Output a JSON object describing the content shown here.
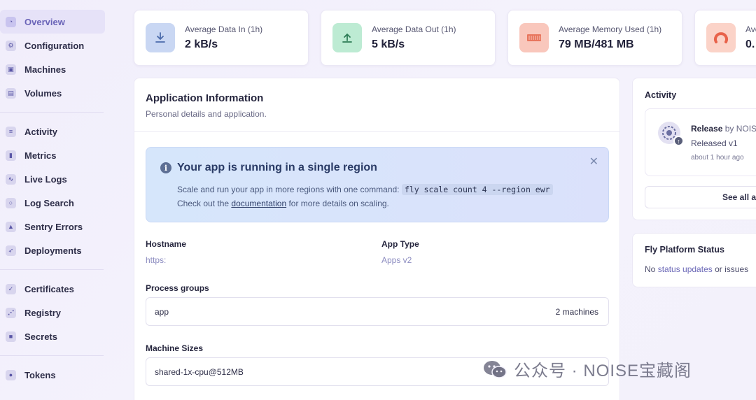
{
  "sidebar": {
    "items": [
      {
        "label": "Overview",
        "icon": "chart-pie-icon",
        "active": true
      },
      {
        "label": "Configuration",
        "icon": "gear-icon"
      },
      {
        "label": "Machines",
        "icon": "cpu-icon"
      },
      {
        "label": "Volumes",
        "icon": "box-icon"
      },
      {
        "label": "Activity",
        "icon": "activity-icon"
      },
      {
        "label": "Metrics",
        "icon": "bar-chart-icon"
      },
      {
        "label": "Live Logs",
        "icon": "waveform-icon"
      },
      {
        "label": "Log Search",
        "icon": "search-icon"
      },
      {
        "label": "Sentry Errors",
        "icon": "triangle-icon"
      },
      {
        "label": "Deployments",
        "icon": "rocket-icon"
      },
      {
        "label": "Certificates",
        "icon": "badge-check-icon"
      },
      {
        "label": "Registry",
        "icon": "share-icon"
      },
      {
        "label": "Secrets",
        "icon": "lock-icon"
      },
      {
        "label": "Tokens",
        "icon": "token-icon"
      }
    ]
  },
  "stats": [
    {
      "label": "Average Data In (1h)",
      "value": "2 kB/s",
      "icon": "download-icon",
      "color": "#c9d7f3"
    },
    {
      "label": "Average Data Out (1h)",
      "value": "5 kB/s",
      "icon": "upload-icon",
      "color": "#bdebd3"
    },
    {
      "label": "Average Memory Used (1h)",
      "value": "79 MB/481 MB",
      "icon": "memory-icon",
      "color": "#f9c7bc"
    },
    {
      "label": "Ave",
      "value": "0.",
      "icon": "gauge-icon",
      "color": "#fbd3c8"
    }
  ],
  "app_info": {
    "title": "Application Information",
    "subtitle": "Personal details and application.",
    "alert": {
      "title": "Your app is running in a single region",
      "line1": "Scale and run your app in more regions with one command:",
      "command": "fly scale count 4 --region ewr",
      "line2_before": "Check out the",
      "link": "documentation",
      "line2_after": "for more details on scaling."
    },
    "hostname_label": "Hostname",
    "hostname_value": "https:",
    "app_type_label": "App Type",
    "app_type_value": "Apps v2",
    "process_groups_label": "Process groups",
    "process_group_name": "app",
    "process_group_count": "2 machines",
    "machine_sizes_label": "Machine Sizes",
    "machine_size": "shared-1x-cpu@512MB"
  },
  "activity": {
    "title": "Activity",
    "release_label": "Release",
    "release_by": "by NOIS",
    "released": "Released v1",
    "time": "about 1 hour ago",
    "see_all": "See all a"
  },
  "platform_status": {
    "title": "Fly Platform Status",
    "no": "No",
    "status_updates": "status updates",
    "or_issues": "or issues"
  },
  "watermark": "公众号 · NOISE宝藏阁"
}
